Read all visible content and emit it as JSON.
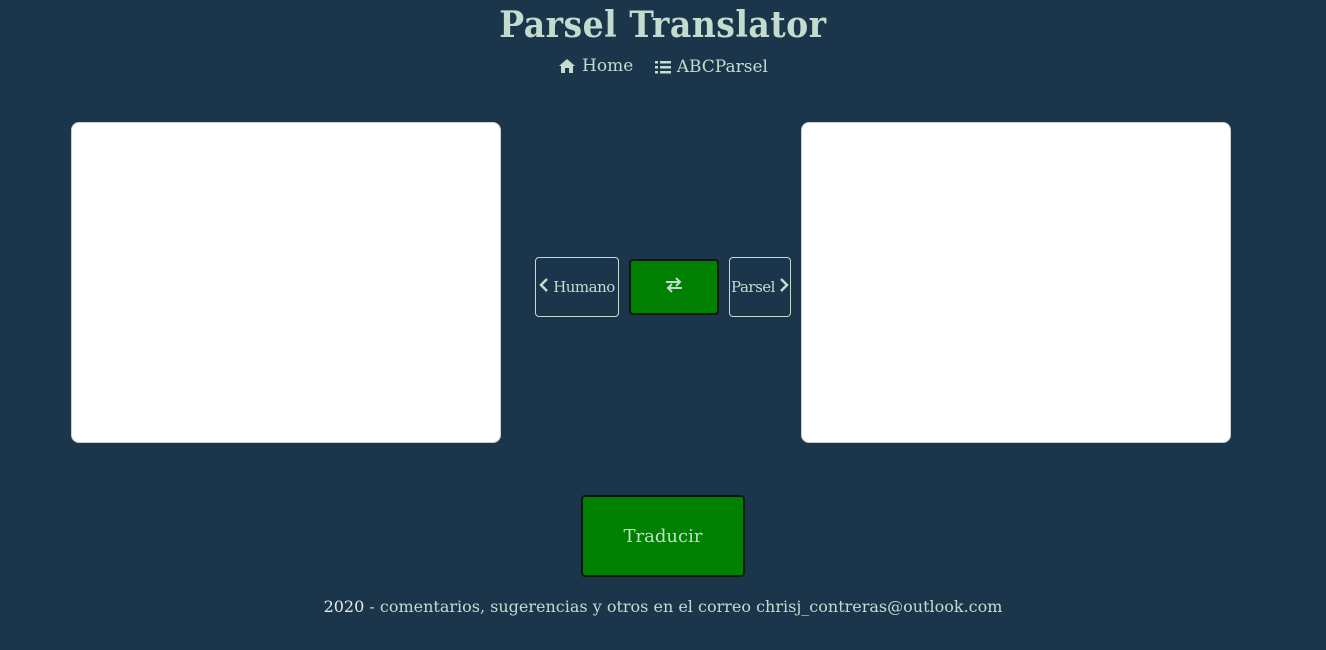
{
  "header": {
    "title": "Parsel Translator"
  },
  "nav": {
    "items": [
      {
        "label": "Home",
        "icon": "home-icon"
      },
      {
        "label": "ABCParsel",
        "icon": "list-icon"
      }
    ]
  },
  "panels": {
    "left_value": "",
    "right_value": ""
  },
  "controls": {
    "source_label": "Humano",
    "target_label": "Parsel",
    "swap_icon": "swap-arrows-icon",
    "translate_label": "Traducir"
  },
  "footer": {
    "year": "2020",
    "text": " - comentarios, sugerencias y otros en el correo chrisj_contreras@outlook.com"
  },
  "colors": {
    "background": "#1b364b",
    "text": "#c3dccf",
    "button_green": "#008000"
  }
}
